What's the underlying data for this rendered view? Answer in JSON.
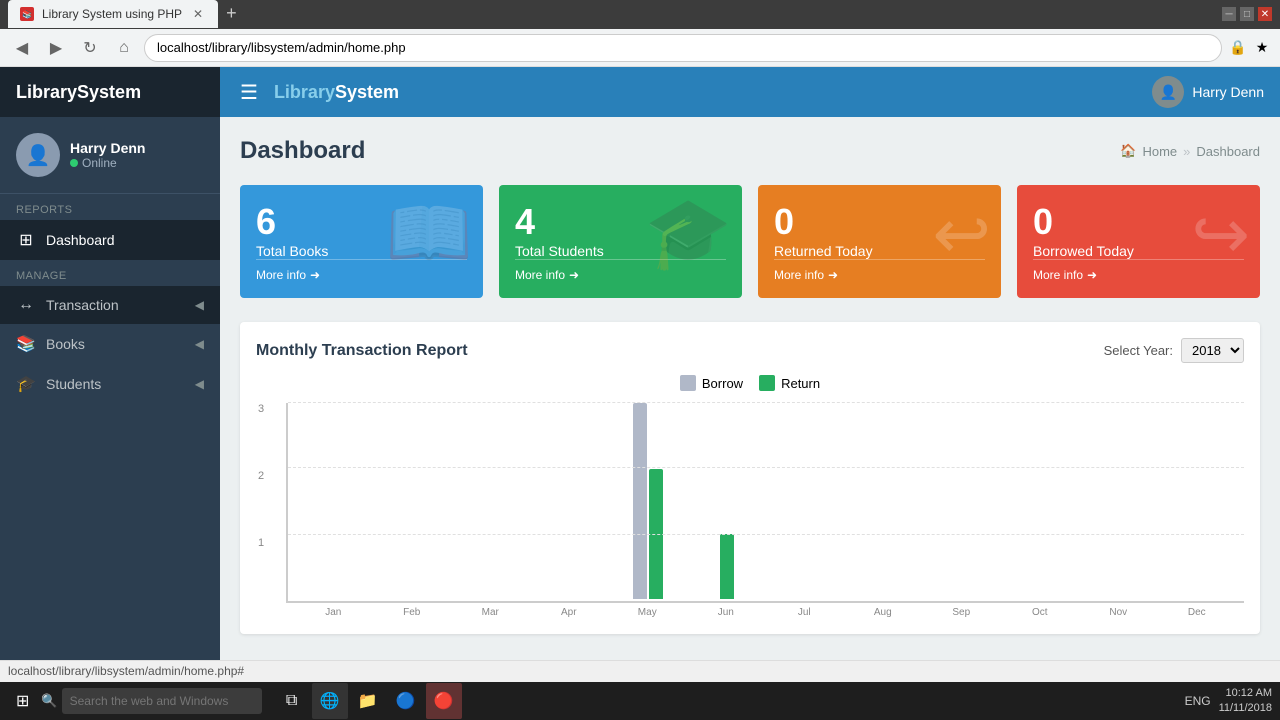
{
  "browser": {
    "tab_title": "Library System using PHP",
    "address": "localhost/library/libsystem/admin/home.php",
    "new_tab_label": "+"
  },
  "topnav": {
    "hamburger": "☰",
    "app_name_blue": "Library",
    "app_name_white": "System",
    "user_name": "Harry Denn"
  },
  "sidebar": {
    "user_name": "Harry Denn",
    "user_status": "Online",
    "reports_label": "REPORTS",
    "manage_label": "MANAGE",
    "items": [
      {
        "id": "dashboard",
        "icon": "⊞",
        "label": "Dashboard",
        "active": true
      },
      {
        "id": "transaction",
        "icon": "↔",
        "label": "Transaction",
        "active": false
      },
      {
        "id": "books",
        "icon": "📚",
        "label": "Books",
        "active": false
      },
      {
        "id": "students",
        "icon": "🎓",
        "label": "Students",
        "active": false
      }
    ]
  },
  "page": {
    "title": "Dashboard",
    "breadcrumb_home": "Home",
    "breadcrumb_current": "Dashboard"
  },
  "stat_cards": [
    {
      "id": "total-books",
      "number": "6",
      "label": "Total Books",
      "color": "blue",
      "icon": "📖",
      "more_info": "More info"
    },
    {
      "id": "total-students",
      "number": "4",
      "label": "Total Students",
      "color": "green",
      "icon": "🎓",
      "more_info": "More info"
    },
    {
      "id": "returned-today",
      "number": "0",
      "label": "Returned Today",
      "color": "orange",
      "icon": "↩",
      "more_info": "More info"
    },
    {
      "id": "borrowed-today",
      "number": "0",
      "label": "Borrowed Today",
      "color": "red",
      "icon": "↪",
      "more_info": "More info"
    }
  ],
  "chart": {
    "title": "Monthly Transaction Report",
    "year_label": "Select Year:",
    "selected_year": "2018",
    "legend_borrow": "Borrow",
    "legend_return": "Return",
    "months": [
      "Jan",
      "Feb",
      "Mar",
      "Apr",
      "May",
      "Jun",
      "Jul",
      "Aug",
      "Sep",
      "Oct",
      "Nov",
      "Dec"
    ],
    "borrow_data": [
      0,
      0,
      0,
      0,
      3,
      0,
      0,
      0,
      0,
      0,
      0,
      0
    ],
    "return_data": [
      0,
      0,
      0,
      0,
      2,
      1,
      0,
      0,
      0,
      0,
      0,
      0
    ],
    "y_max": 3
  },
  "status_bar": {
    "url": "localhost/library/libsystem/admin/home.php#"
  },
  "taskbar": {
    "search_placeholder": "Search the web and Windows",
    "time": "10:12 AM",
    "date": "11/11/2018",
    "lang": "ENG"
  }
}
